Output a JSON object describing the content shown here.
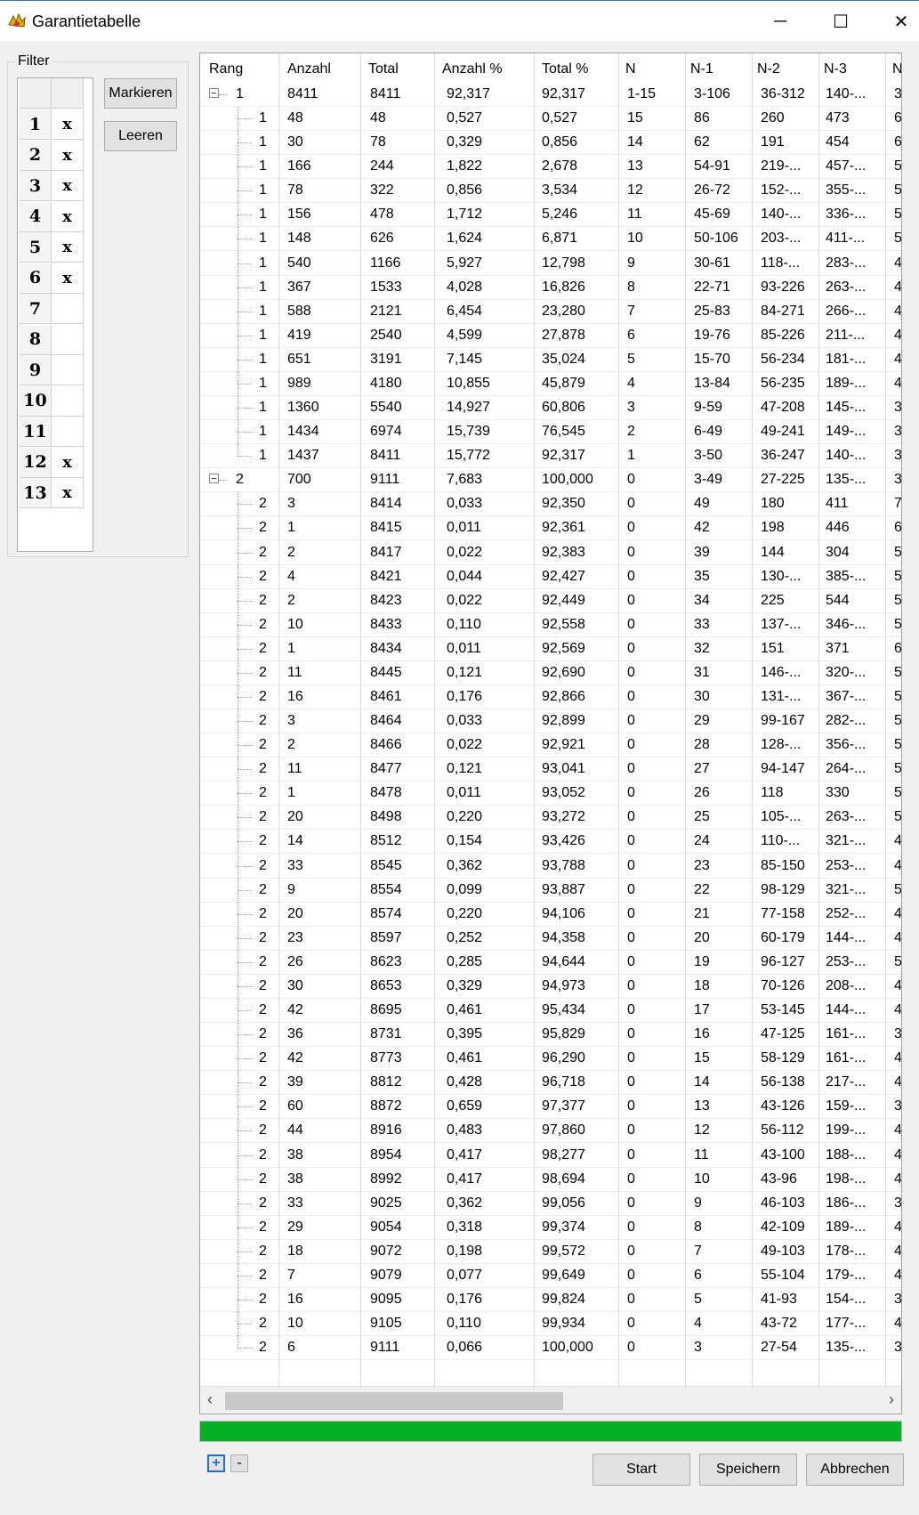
{
  "window": {
    "title": "Garantietabelle",
    "controls": {
      "minimize": "─",
      "maximize": "☐",
      "close": "✕"
    }
  },
  "filter": {
    "legend": "Filter",
    "rows": [
      {
        "num": "1",
        "mark": "x"
      },
      {
        "num": "2",
        "mark": "x"
      },
      {
        "num": "3",
        "mark": "x"
      },
      {
        "num": "4",
        "mark": "x"
      },
      {
        "num": "5",
        "mark": "x"
      },
      {
        "num": "6",
        "mark": "x"
      },
      {
        "num": "7",
        "mark": ""
      },
      {
        "num": "8",
        "mark": ""
      },
      {
        "num": "9",
        "mark": ""
      },
      {
        "num": "10",
        "mark": ""
      },
      {
        "num": "11",
        "mark": ""
      },
      {
        "num": "12",
        "mark": "x"
      },
      {
        "num": "13",
        "mark": "x"
      }
    ],
    "buttons": {
      "mark": "Markieren",
      "clear": "Leeren"
    }
  },
  "table": {
    "columns": [
      "Rang",
      "Anzahl",
      "Total",
      "Anzahl %",
      "Total %",
      "N",
      "N-1",
      "N-2",
      "N-3",
      "N"
    ],
    "rows": [
      {
        "level": 0,
        "expand": "−",
        "rang": "1",
        "anzahl": "8411",
        "total": "8411",
        "anzahl_pct": "92,317",
        "total_pct": "92,317",
        "n": "1-15",
        "n1": "3-106",
        "n2": "36-312",
        "n3": "140-...",
        "n4": "3"
      },
      {
        "level": 1,
        "rang": "1",
        "anzahl": "48",
        "total": "48",
        "anzahl_pct": "0,527",
        "total_pct": "0,527",
        "n": "15",
        "n1": "86",
        "n2": "260",
        "n3": "473",
        "n4": "6"
      },
      {
        "level": 1,
        "rang": "1",
        "anzahl": "30",
        "total": "78",
        "anzahl_pct": "0,329",
        "total_pct": "0,856",
        "n": "14",
        "n1": "62",
        "n2": "191",
        "n3": "454",
        "n4": "6"
      },
      {
        "level": 1,
        "rang": "1",
        "anzahl": "166",
        "total": "244",
        "anzahl_pct": "1,822",
        "total_pct": "2,678",
        "n": "13",
        "n1": "54-91",
        "n2": "219-...",
        "n3": "457-...",
        "n4": "5"
      },
      {
        "level": 1,
        "rang": "1",
        "anzahl": "78",
        "total": "322",
        "anzahl_pct": "0,856",
        "total_pct": "3,534",
        "n": "12",
        "n1": "26-72",
        "n2": "152-...",
        "n3": "355-...",
        "n4": "5"
      },
      {
        "level": 1,
        "rang": "1",
        "anzahl": "156",
        "total": "478",
        "anzahl_pct": "1,712",
        "total_pct": "5,246",
        "n": "11",
        "n1": "45-69",
        "n2": "140-...",
        "n3": "336-...",
        "n4": "5"
      },
      {
        "level": 1,
        "rang": "1",
        "anzahl": "148",
        "total": "626",
        "anzahl_pct": "1,624",
        "total_pct": "6,871",
        "n": "10",
        "n1": "50-106",
        "n2": "203-...",
        "n3": "411-...",
        "n4": "5"
      },
      {
        "level": 1,
        "rang": "1",
        "anzahl": "540",
        "total": "1166",
        "anzahl_pct": "5,927",
        "total_pct": "12,798",
        "n": "9",
        "n1": "30-61",
        "n2": "118-...",
        "n3": "283-...",
        "n4": "4"
      },
      {
        "level": 1,
        "rang": "1",
        "anzahl": "367",
        "total": "1533",
        "anzahl_pct": "4,028",
        "total_pct": "16,826",
        "n": "8",
        "n1": "22-71",
        "n2": "93-226",
        "n3": "263-...",
        "n4": "4"
      },
      {
        "level": 1,
        "rang": "1",
        "anzahl": "588",
        "total": "2121",
        "anzahl_pct": "6,454",
        "total_pct": "23,280",
        "n": "7",
        "n1": "25-83",
        "n2": "84-271",
        "n3": "266-...",
        "n4": "4"
      },
      {
        "level": 1,
        "rang": "1",
        "anzahl": "419",
        "total": "2540",
        "anzahl_pct": "4,599",
        "total_pct": "27,878",
        "n": "6",
        "n1": "19-76",
        "n2": "85-226",
        "n3": "211-...",
        "n4": "4"
      },
      {
        "level": 1,
        "rang": "1",
        "anzahl": "651",
        "total": "3191",
        "anzahl_pct": "7,145",
        "total_pct": "35,024",
        "n": "5",
        "n1": "15-70",
        "n2": "56-234",
        "n3": "181-...",
        "n4": "4"
      },
      {
        "level": 1,
        "rang": "1",
        "anzahl": "989",
        "total": "4180",
        "anzahl_pct": "10,855",
        "total_pct": "45,879",
        "n": "4",
        "n1": "13-84",
        "n2": "56-235",
        "n3": "189-...",
        "n4": "4"
      },
      {
        "level": 1,
        "rang": "1",
        "anzahl": "1360",
        "total": "5540",
        "anzahl_pct": "14,927",
        "total_pct": "60,806",
        "n": "3",
        "n1": "9-59",
        "n2": "47-208",
        "n3": "145-...",
        "n4": "3"
      },
      {
        "level": 1,
        "rang": "1",
        "anzahl": "1434",
        "total": "6974",
        "anzahl_pct": "15,739",
        "total_pct": "76,545",
        "n": "2",
        "n1": "6-49",
        "n2": "49-241",
        "n3": "149-...",
        "n4": "3"
      },
      {
        "level": 1,
        "last": true,
        "rang": "1",
        "anzahl": "1437",
        "total": "8411",
        "anzahl_pct": "15,772",
        "total_pct": "92,317",
        "n": "1",
        "n1": "3-50",
        "n2": "36-247",
        "n3": "140-...",
        "n4": "3"
      },
      {
        "level": 0,
        "expand": "−",
        "rang": "2",
        "anzahl": "700",
        "total": "9111",
        "anzahl_pct": "7,683",
        "total_pct": "100,000",
        "n": "0",
        "n1": "3-49",
        "n2": "27-225",
        "n3": "135-...",
        "n4": "3"
      },
      {
        "level": 1,
        "rang": "2",
        "anzahl": "3",
        "total": "8414",
        "anzahl_pct": "0,033",
        "total_pct": "92,350",
        "n": "0",
        "n1": "49",
        "n2": "180",
        "n3": "411",
        "n4": "7"
      },
      {
        "level": 1,
        "rang": "2",
        "anzahl": "1",
        "total": "8415",
        "anzahl_pct": "0,011",
        "total_pct": "92,361",
        "n": "0",
        "n1": "42",
        "n2": "198",
        "n3": "446",
        "n4": "6"
      },
      {
        "level": 1,
        "rang": "2",
        "anzahl": "2",
        "total": "8417",
        "anzahl_pct": "0,022",
        "total_pct": "92,383",
        "n": "0",
        "n1": "39",
        "n2": "144",
        "n3": "304",
        "n4": "5"
      },
      {
        "level": 1,
        "rang": "2",
        "anzahl": "4",
        "total": "8421",
        "anzahl_pct": "0,044",
        "total_pct": "92,427",
        "n": "0",
        "n1": "35",
        "n2": "130-...",
        "n3": "385-...",
        "n4": "5"
      },
      {
        "level": 1,
        "rang": "2",
        "anzahl": "2",
        "total": "8423",
        "anzahl_pct": "0,022",
        "total_pct": "92,449",
        "n": "0",
        "n1": "34",
        "n2": "225",
        "n3": "544",
        "n4": "5"
      },
      {
        "level": 1,
        "rang": "2",
        "anzahl": "10",
        "total": "8433",
        "anzahl_pct": "0,110",
        "total_pct": "92,558",
        "n": "0",
        "n1": "33",
        "n2": "137-...",
        "n3": "346-...",
        "n4": "5"
      },
      {
        "level": 1,
        "rang": "2",
        "anzahl": "1",
        "total": "8434",
        "anzahl_pct": "0,011",
        "total_pct": "92,569",
        "n": "0",
        "n1": "32",
        "n2": "151",
        "n3": "371",
        "n4": "6"
      },
      {
        "level": 1,
        "rang": "2",
        "anzahl": "11",
        "total": "8445",
        "anzahl_pct": "0,121",
        "total_pct": "92,690",
        "n": "0",
        "n1": "31",
        "n2": "146-...",
        "n3": "320-...",
        "n4": "5"
      },
      {
        "level": 1,
        "rang": "2",
        "anzahl": "16",
        "total": "8461",
        "anzahl_pct": "0,176",
        "total_pct": "92,866",
        "n": "0",
        "n1": "30",
        "n2": "131-...",
        "n3": "367-...",
        "n4": "5"
      },
      {
        "level": 1,
        "rang": "2",
        "anzahl": "3",
        "total": "8464",
        "anzahl_pct": "0,033",
        "total_pct": "92,899",
        "n": "0",
        "n1": "29",
        "n2": "99-167",
        "n3": "282-...",
        "n4": "5"
      },
      {
        "level": 1,
        "rang": "2",
        "anzahl": "2",
        "total": "8466",
        "anzahl_pct": "0,022",
        "total_pct": "92,921",
        "n": "0",
        "n1": "28",
        "n2": "128-...",
        "n3": "356-...",
        "n4": "5"
      },
      {
        "level": 1,
        "rang": "2",
        "anzahl": "11",
        "total": "8477",
        "anzahl_pct": "0,121",
        "total_pct": "93,041",
        "n": "0",
        "n1": "27",
        "n2": "94-147",
        "n3": "264-...",
        "n4": "5"
      },
      {
        "level": 1,
        "rang": "2",
        "anzahl": "1",
        "total": "8478",
        "anzahl_pct": "0,011",
        "total_pct": "93,052",
        "n": "0",
        "n1": "26",
        "n2": "118",
        "n3": "330",
        "n4": "5"
      },
      {
        "level": 1,
        "rang": "2",
        "anzahl": "20",
        "total": "8498",
        "anzahl_pct": "0,220",
        "total_pct": "93,272",
        "n": "0",
        "n1": "25",
        "n2": "105-...",
        "n3": "263-...",
        "n4": "5"
      },
      {
        "level": 1,
        "rang": "2",
        "anzahl": "14",
        "total": "8512",
        "anzahl_pct": "0,154",
        "total_pct": "93,426",
        "n": "0",
        "n1": "24",
        "n2": "110-...",
        "n3": "321-...",
        "n4": "4"
      },
      {
        "level": 1,
        "rang": "2",
        "anzahl": "33",
        "total": "8545",
        "anzahl_pct": "0,362",
        "total_pct": "93,788",
        "n": "0",
        "n1": "23",
        "n2": "85-150",
        "n3": "253-...",
        "n4": "4"
      },
      {
        "level": 1,
        "rang": "2",
        "anzahl": "9",
        "total": "8554",
        "anzahl_pct": "0,099",
        "total_pct": "93,887",
        "n": "0",
        "n1": "22",
        "n2": "98-129",
        "n3": "321-...",
        "n4": "5"
      },
      {
        "level": 1,
        "rang": "2",
        "anzahl": "20",
        "total": "8574",
        "anzahl_pct": "0,220",
        "total_pct": "94,106",
        "n": "0",
        "n1": "21",
        "n2": "77-158",
        "n3": "252-...",
        "n4": "4"
      },
      {
        "level": 1,
        "rang": "2",
        "anzahl": "23",
        "total": "8597",
        "anzahl_pct": "0,252",
        "total_pct": "94,358",
        "n": "0",
        "n1": "20",
        "n2": "60-179",
        "n3": "144-...",
        "n4": "4"
      },
      {
        "level": 1,
        "rang": "2",
        "anzahl": "26",
        "total": "8623",
        "anzahl_pct": "0,285",
        "total_pct": "94,644",
        "n": "0",
        "n1": "19",
        "n2": "96-127",
        "n3": "253-...",
        "n4": "5"
      },
      {
        "level": 1,
        "rang": "2",
        "anzahl": "30",
        "total": "8653",
        "anzahl_pct": "0,329",
        "total_pct": "94,973",
        "n": "0",
        "n1": "18",
        "n2": "70-126",
        "n3": "208-...",
        "n4": "4"
      },
      {
        "level": 1,
        "rang": "2",
        "anzahl": "42",
        "total": "8695",
        "anzahl_pct": "0,461",
        "total_pct": "95,434",
        "n": "0",
        "n1": "17",
        "n2": "53-145",
        "n3": "144-...",
        "n4": "4"
      },
      {
        "level": 1,
        "rang": "2",
        "anzahl": "36",
        "total": "8731",
        "anzahl_pct": "0,395",
        "total_pct": "95,829",
        "n": "0",
        "n1": "16",
        "n2": "47-125",
        "n3": "161-...",
        "n4": "3"
      },
      {
        "level": 1,
        "rang": "2",
        "anzahl": "42",
        "total": "8773",
        "anzahl_pct": "0,461",
        "total_pct": "96,290",
        "n": "0",
        "n1": "15",
        "n2": "58-129",
        "n3": "161-...",
        "n4": "4"
      },
      {
        "level": 1,
        "rang": "2",
        "anzahl": "39",
        "total": "8812",
        "anzahl_pct": "0,428",
        "total_pct": "96,718",
        "n": "0",
        "n1": "14",
        "n2": "56-138",
        "n3": "217-...",
        "n4": "4"
      },
      {
        "level": 1,
        "rang": "2",
        "anzahl": "60",
        "total": "8872",
        "anzahl_pct": "0,659",
        "total_pct": "97,377",
        "n": "0",
        "n1": "13",
        "n2": "43-126",
        "n3": "159-...",
        "n4": "3"
      },
      {
        "level": 1,
        "rang": "2",
        "anzahl": "44",
        "total": "8916",
        "anzahl_pct": "0,483",
        "total_pct": "97,860",
        "n": "0",
        "n1": "12",
        "n2": "56-112",
        "n3": "199-...",
        "n4": "4"
      },
      {
        "level": 1,
        "rang": "2",
        "anzahl": "38",
        "total": "8954",
        "anzahl_pct": "0,417",
        "total_pct": "98,277",
        "n": "0",
        "n1": "11",
        "n2": "43-100",
        "n3": "188-...",
        "n4": "4"
      },
      {
        "level": 1,
        "rang": "2",
        "anzahl": "38",
        "total": "8992",
        "anzahl_pct": "0,417",
        "total_pct": "98,694",
        "n": "0",
        "n1": "10",
        "n2": "43-96",
        "n3": "198-...",
        "n4": "4"
      },
      {
        "level": 1,
        "rang": "2",
        "anzahl": "33",
        "total": "9025",
        "anzahl_pct": "0,362",
        "total_pct": "99,056",
        "n": "0",
        "n1": "9",
        "n2": "46-103",
        "n3": "186-...",
        "n4": "3"
      },
      {
        "level": 1,
        "rang": "2",
        "anzahl": "29",
        "total": "9054",
        "anzahl_pct": "0,318",
        "total_pct": "99,374",
        "n": "0",
        "n1": "8",
        "n2": "42-109",
        "n3": "189-...",
        "n4": "4"
      },
      {
        "level": 1,
        "rang": "2",
        "anzahl": "18",
        "total": "9072",
        "anzahl_pct": "0,198",
        "total_pct": "99,572",
        "n": "0",
        "n1": "7",
        "n2": "49-103",
        "n3": "178-...",
        "n4": "4"
      },
      {
        "level": 1,
        "rang": "2",
        "anzahl": "7",
        "total": "9079",
        "anzahl_pct": "0,077",
        "total_pct": "99,649",
        "n": "0",
        "n1": "6",
        "n2": "55-104",
        "n3": "179-...",
        "n4": "4"
      },
      {
        "level": 1,
        "rang": "2",
        "anzahl": "16",
        "total": "9095",
        "anzahl_pct": "0,176",
        "total_pct": "99,824",
        "n": "0",
        "n1": "5",
        "n2": "41-93",
        "n3": "154-...",
        "n4": "3"
      },
      {
        "level": 1,
        "rang": "2",
        "anzahl": "10",
        "total": "9105",
        "anzahl_pct": "0,110",
        "total_pct": "99,934",
        "n": "0",
        "n1": "4",
        "n2": "43-72",
        "n3": "177-...",
        "n4": "4"
      },
      {
        "level": 1,
        "last": true,
        "rang": "2",
        "anzahl": "6",
        "total": "9111",
        "anzahl_pct": "0,066",
        "total_pct": "100,000",
        "n": "0",
        "n1": "3",
        "n2": "27-54",
        "n3": "135-...",
        "n4": "3"
      }
    ]
  },
  "scrollbar": {
    "left_arrow": "‹",
    "right_arrow": "›"
  },
  "progress": {
    "fraction": 1.0,
    "color": "#06b025"
  },
  "tree_buttons": {
    "expand_all": "+",
    "collapse_all": "-"
  },
  "bottom_buttons": {
    "start": "Start",
    "save": "Speichern",
    "cancel": "Abbrechen"
  }
}
